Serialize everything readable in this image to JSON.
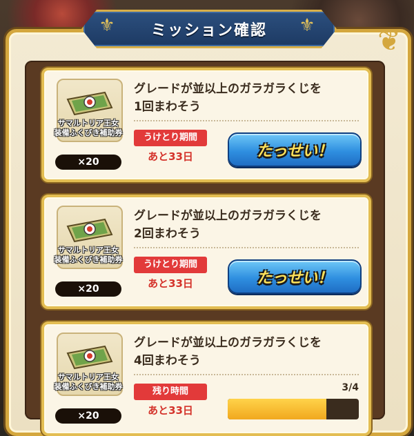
{
  "header": {
    "title": "ミッション確認"
  },
  "colors": {
    "banner_blue": "#1d3a63",
    "gold_border": "#e3bd52",
    "achieve_button": "#2f8fe0",
    "red_badge": "#e23a3a",
    "progress_fill": "#f1a81e"
  },
  "missions": [
    {
      "title_line1": "グレードが並以上のガラガラくじを",
      "title_line2": "1回まわそう",
      "reward_name_line1": "サマルトリア王女",
      "reward_name_line2": "装備ふくびき補助券",
      "reward_icon": "ticket-icon",
      "reward_qty": "×20",
      "badge_label": "うけとり期間",
      "remaining": "あと33日",
      "button_label": "たっせい！"
    },
    {
      "title_line1": "グレードが並以上のガラガラくじを",
      "title_line2": "2回まわそう",
      "reward_name_line1": "サマルトリア王女",
      "reward_name_line2": "装備ふくびき補助券",
      "reward_icon": "ticket-icon",
      "reward_qty": "×20",
      "badge_label": "うけとり期間",
      "remaining": "あと33日",
      "button_label": "たっせい！"
    },
    {
      "title_line1": "グレードが並以上のガラガラくじを",
      "title_line2": "4回まわそう",
      "reward_name_line1": "サマルトリア王女",
      "reward_name_line2": "装備ふくびき補助券",
      "reward_icon": "ticket-icon",
      "reward_qty": "×20",
      "badge_label": "残り時間",
      "remaining": "あと33日",
      "progress_text": "3/4",
      "progress_fraction": 0.75
    }
  ]
}
